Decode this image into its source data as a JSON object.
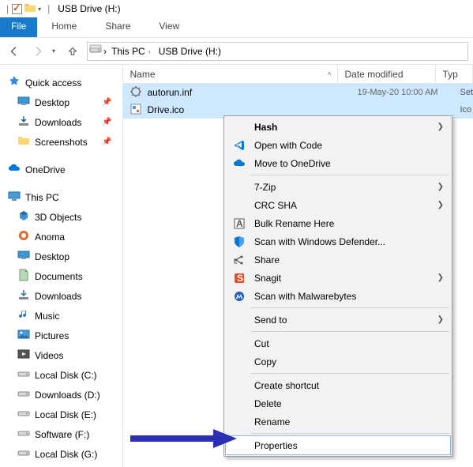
{
  "titlebar": {
    "title": "USB Drive (H:)"
  },
  "ribbon": {
    "file": "File",
    "home": "Home",
    "share": "Share",
    "view": "View"
  },
  "breadcrumb": {
    "root": "This PC",
    "leaf": "USB Drive (H:)"
  },
  "columns": {
    "name": "Name",
    "date": "Date modified",
    "type": "Typ"
  },
  "nav": {
    "quick_access": "Quick access",
    "desktop": "Desktop",
    "downloads": "Downloads",
    "screenshots": "Screenshots",
    "onedrive": "OneDrive",
    "this_pc": "This PC",
    "objects3d": "3D Objects",
    "anoma": "Anoma",
    "desktop2": "Desktop",
    "documents": "Documents",
    "downloads2": "Downloads",
    "music": "Music",
    "pictures": "Pictures",
    "videos": "Videos",
    "disk_c": "Local Disk (C:)",
    "disk_d": "Downloads  (D:)",
    "disk_e": "Local Disk (E:)",
    "disk_f": "Software (F:)",
    "disk_g": "Local Disk (G:)"
  },
  "files": [
    {
      "name": "autorun.inf",
      "date": "19-May-20 10:00 AM",
      "type": "Set"
    },
    {
      "name": "Drive.ico",
      "date": "",
      "type": "Ico"
    }
  ],
  "ctx": {
    "hash": "Hash",
    "open_code": "Open with Code",
    "onedrive": "Move to OneDrive",
    "sevenzip": "7-Zip",
    "crcsha": "CRC SHA",
    "bulk": "Bulk Rename Here",
    "defender": "Scan with Windows Defender...",
    "share": "Share",
    "snagit": "Snagit",
    "malwarebytes": "Scan with Malwarebytes",
    "sendto": "Send to",
    "cut": "Cut",
    "copy": "Copy",
    "shortcut": "Create shortcut",
    "delete": "Delete",
    "rename": "Rename",
    "properties": "Properties"
  }
}
